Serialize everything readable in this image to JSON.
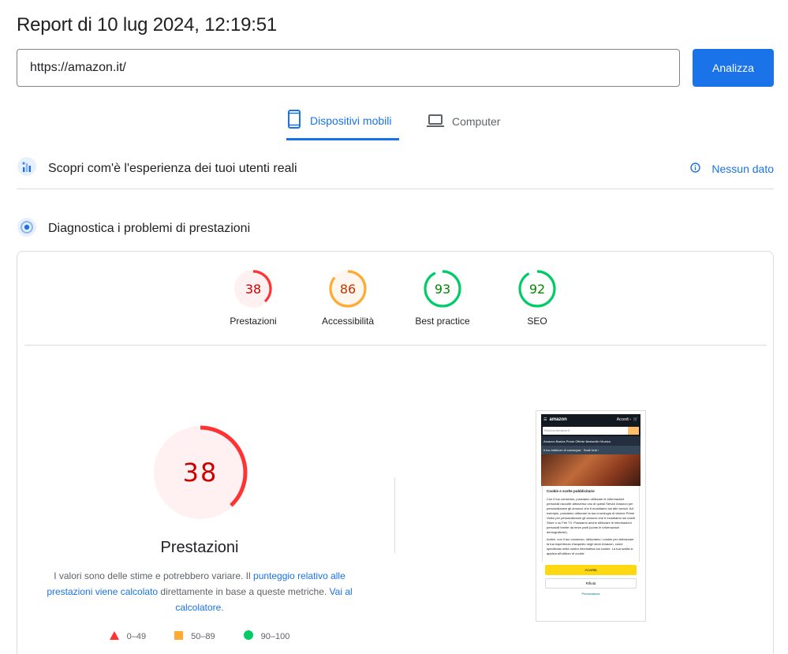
{
  "report": {
    "title": "Report di 10 lug 2024, 12:19:51"
  },
  "url_bar": {
    "value": "https://amazon.it/",
    "analyze_label": "Analizza"
  },
  "tabs": [
    {
      "label": "Dispositivi mobili",
      "icon": "smartphone-icon",
      "active": true
    },
    {
      "label": "Computer",
      "icon": "laptop-icon",
      "active": false
    }
  ],
  "crux": {
    "title": "Scopri com'è l'esperienza dei tuoi utenti reali",
    "status": "Nessun dato"
  },
  "diagnostics": {
    "title": "Diagnostica i problemi di prestazioni"
  },
  "scores": [
    {
      "name": "Prestazioni",
      "value": 38,
      "color": "#ff3333",
      "bg": "#fff1f1"
    },
    {
      "name": "Accessibilità",
      "value": 86,
      "color": "#ffaa33",
      "bg": "#fff7ee"
    },
    {
      "name": "Best practice",
      "value": 93,
      "color": "#00cc66",
      "bg": "#ffffff"
    },
    {
      "name": "SEO",
      "value": 92,
      "color": "#00cc66",
      "bg": "#ffffff"
    }
  ],
  "performance": {
    "value": 38,
    "title": "Prestazioni",
    "desc_1": "I valori sono delle stime e potrebbero variare. Il ",
    "desc_link_1": "punteggio relativo alle prestazioni viene calcolato",
    "desc_2": " direttamente in base a queste metriche. ",
    "desc_link_2": "Vai al calcolatore."
  },
  "legend": [
    {
      "range": "0–49",
      "shape": "triangle",
      "color": "#ff3333"
    },
    {
      "range": "50–89",
      "shape": "square",
      "color": "#ffaa33"
    },
    {
      "range": "90–100",
      "shape": "circle",
      "color": "#00cc66"
    }
  ],
  "screenshot": {
    "logo": "amazon",
    "account": "Accedi ›",
    "search_placeholder": "Ricerca Amazon.it",
    "nav": "Amazon Basics   Prime   Offerte   Bestseller   Musica",
    "location": "Il tuo indirizzo di consegna · Scali Unit ›",
    "cookie_title": "Cookie e scelte pubblicitarie",
    "cookie_text_1": "Con il tuo consenso, possiamo utilizzare le informazioni personali raccolte attraverso uno di questi Servizi Amazon per personalizzare gli annunci che ti mostriamo sui altri servizi. Ad esempio, possiamo utilizzare la tua cronologia di visione Prime Video per personalizzare gli annunci che ti mostriamo sui nostri Store o su Fire TV. Possiamo anche utilizzare le informazioni personali fornite da terze parti (come le informazioni demografiche).",
    "cookie_text_2": "Inoltre, con il tuo consenso, utilizziamo i cookie per ottimizzare la tua esperienza d'acquisto negli store Amazon, come specificato nella nostra Informativa sui cookie. La tua scelta si applica all'utilizzo di cookie",
    "accept": "Accetta",
    "reject": "Rifiuta",
    "customize": "Personalizza"
  }
}
